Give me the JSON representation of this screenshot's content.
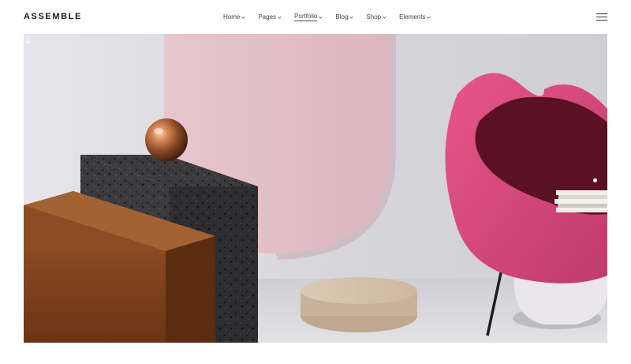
{
  "header": {
    "logo": "ASSEMBLE",
    "nav": [
      {
        "label": "Home",
        "active": false
      },
      {
        "label": "Pages",
        "active": false
      },
      {
        "label": "Portfolio",
        "active": true
      },
      {
        "label": "Blog",
        "active": false
      },
      {
        "label": "Shop",
        "active": false
      },
      {
        "label": "Elements",
        "active": false
      }
    ],
    "menu_icon": "hamburger-icon"
  },
  "hero": {
    "scroll_icon": "arrow-down-icon",
    "slider_dots": 1,
    "active_slide": 1
  },
  "colors": {
    "text": "#1b1b1b",
    "nav_text": "#444444",
    "background": "#ffffff",
    "hero_wall": "#d9d8de",
    "pink_arch": "#e2bfc8",
    "chair_pink": "#d9487a",
    "chair_inner": "#5a1124",
    "copper_box": "#8a4a22",
    "terrazzo_dark": "#3a3a3c",
    "wood_disc": "#d6c3ad"
  }
}
